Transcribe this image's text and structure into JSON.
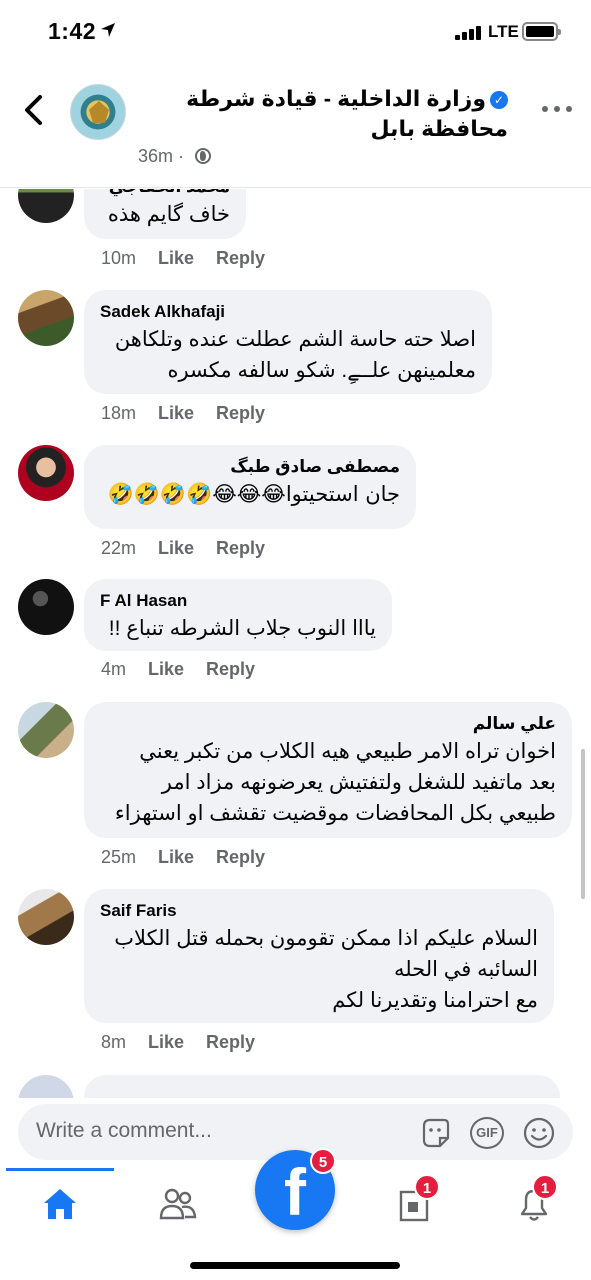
{
  "status_bar": {
    "time": "1:42",
    "network": "LTE"
  },
  "header": {
    "title": "وزارة الداخلية - قيادة شرطة محافظة بابل",
    "time": "36m"
  },
  "comments": [
    {
      "author": "محمد الخفاجي",
      "text_lines": [
        "خاف گايم هذه"
      ],
      "time": "10m",
      "like": "Like",
      "reply": "Reply"
    },
    {
      "author": "Sadek Alkhafaji",
      "text_lines": [
        "اصلا حته حاسة الشم عطلت عنده وتلكاهن",
        "معلمينهن علــےِ. شكو سالفه مكسره"
      ],
      "time": "18m",
      "like": "Like",
      "reply": "Reply"
    },
    {
      "author": "مصطفى صادق طبگ",
      "text_lines": [
        "جان استحيتوا😂😂😂🤣🤣🤣🤣"
      ],
      "time": "22m",
      "like": "Like",
      "reply": "Reply"
    },
    {
      "author": "F Al Hasan",
      "text_lines": [
        "يااا النوب جلاب الشرطه تنباع !!"
      ],
      "time": "4m",
      "like": "Like",
      "reply": "Reply"
    },
    {
      "author": "علي سالم",
      "text_lines": [
        "اخوان تراه الامر طبيعي هيه الكلاب من تكبر يعني",
        "بعد ماتفيد للشغل ولتفتيش يعرضونهه مزاد امر",
        "طبيعي بكل المحافضات موقضيت تقشف او استهزاء"
      ],
      "time": "25m",
      "like": "Like",
      "reply": "Reply"
    },
    {
      "author": "Saif Faris",
      "text_lines": [
        "السلام عليكم اذا ممكن تقومون بحمله قتل الكلاب",
        "السائبه في الحله",
        "مع احترامنا وتقديرنا لكم"
      ],
      "time": "8m",
      "like": "Like",
      "reply": "Reply"
    }
  ],
  "composer": {
    "placeholder": "Write a comment...",
    "gif_label": "GIF"
  },
  "tabbar": {
    "accent": "#1877f2",
    "badges": {
      "facebook": "5",
      "pages": "1",
      "notifications": "1"
    }
  }
}
